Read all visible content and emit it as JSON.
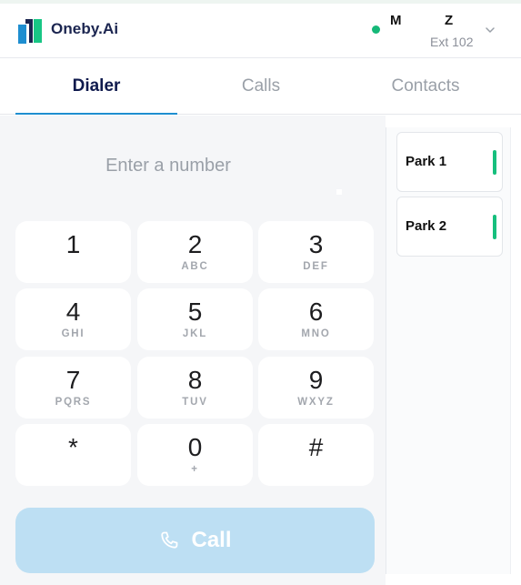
{
  "header": {
    "brand_name": "Oneby.Ai",
    "user_first_initial": "M",
    "user_last_initial": "Z",
    "extension": "Ext 102",
    "status_color": "#15b878"
  },
  "tabs": [
    {
      "label": "Dialer",
      "active": true
    },
    {
      "label": "Calls",
      "active": false
    },
    {
      "label": "Contacts",
      "active": false
    }
  ],
  "dialer": {
    "placeholder": "Enter a number",
    "keys": [
      {
        "digit": "1",
        "letters": ""
      },
      {
        "digit": "2",
        "letters": "ABC"
      },
      {
        "digit": "3",
        "letters": "DEF"
      },
      {
        "digit": "4",
        "letters": "GHI"
      },
      {
        "digit": "5",
        "letters": "JKL"
      },
      {
        "digit": "6",
        "letters": "MNO"
      },
      {
        "digit": "7",
        "letters": "PQRS"
      },
      {
        "digit": "8",
        "letters": "TUV"
      },
      {
        "digit": "9",
        "letters": "WXYZ"
      },
      {
        "digit": "*",
        "letters": ""
      },
      {
        "digit": "0",
        "letters": "+"
      },
      {
        "digit": "#",
        "letters": ""
      }
    ],
    "call_label": "Call",
    "call_color": "#bddff3"
  },
  "parks": [
    {
      "label": "Park 1",
      "status_color": "#16bf7d"
    },
    {
      "label": "Park 2",
      "status_color": "#16bf7d"
    }
  ],
  "icons": {
    "logo": "oneby-logo-icon",
    "chevron": "chevron-down-icon",
    "phone": "phone-icon"
  }
}
